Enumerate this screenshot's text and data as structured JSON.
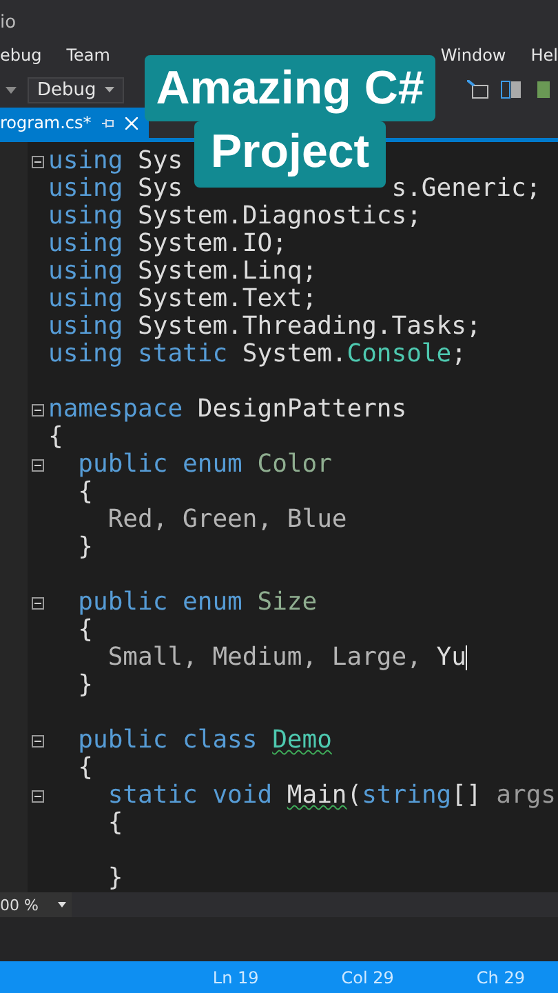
{
  "window": {
    "title": "io"
  },
  "menu": [
    {
      "kind": "item",
      "label": "ebug"
    },
    {
      "kind": "item",
      "label": "Team"
    },
    {
      "kind": "gap"
    },
    {
      "kind": "item",
      "label": "Window"
    },
    {
      "kind": "item",
      "label": "Hel"
    }
  ],
  "toolbar": {
    "configuration": "Debug"
  },
  "tab": {
    "label": "rogram.cs*",
    "selected": true
  },
  "code_lines": [
    {
      "fold": true,
      "tokens": [
        {
          "kind": "keyword",
          "text": "using"
        },
        {
          "kind": "plain",
          "text": " Sys"
        }
      ]
    },
    {
      "fold": false,
      "tokens": [
        {
          "kind": "keyword",
          "text": "using"
        },
        {
          "kind": "plain",
          "text": " Sys"
        },
        {
          "kind": "gap"
        },
        {
          "kind": "plain",
          "text": "s.Generic;"
        }
      ]
    },
    {
      "fold": false,
      "tokens": [
        {
          "kind": "keyword",
          "text": "using"
        },
        {
          "kind": "plain",
          "text": " System.Diagnostics;"
        }
      ]
    },
    {
      "fold": false,
      "tokens": [
        {
          "kind": "keyword",
          "text": "using"
        },
        {
          "kind": "plain",
          "text": " System.IO;"
        }
      ]
    },
    {
      "fold": false,
      "tokens": [
        {
          "kind": "keyword",
          "text": "using"
        },
        {
          "kind": "plain",
          "text": " System.Linq;"
        }
      ]
    },
    {
      "fold": false,
      "tokens": [
        {
          "kind": "keyword",
          "text": "using"
        },
        {
          "kind": "plain",
          "text": " System.Text;"
        }
      ]
    },
    {
      "fold": false,
      "tokens": [
        {
          "kind": "keyword",
          "text": "using"
        },
        {
          "kind": "plain",
          "text": " System.Threading.Tasks;"
        }
      ]
    },
    {
      "fold": false,
      "tokens": [
        {
          "kind": "keyword",
          "text": "using static"
        },
        {
          "kind": "plain",
          "text": " System."
        },
        {
          "kind": "type",
          "text": "Console"
        },
        {
          "kind": "plain",
          "text": ";"
        }
      ]
    },
    {
      "fold": false
    },
    {
      "fold": true,
      "tokens": [
        {
          "kind": "keyword",
          "text": "namespace"
        },
        {
          "kind": "plain",
          "text": " DesignPatterns"
        }
      ]
    },
    {
      "fold": false,
      "tokens": [
        {
          "kind": "plain",
          "text": "{"
        }
      ]
    },
    {
      "fold": true,
      "tokens": [
        {
          "kind": "keyword",
          "text": "  public enum"
        },
        {
          "kind": "enum",
          "text": " Color"
        }
      ]
    },
    {
      "fold": false,
      "tokens": [
        {
          "kind": "plain",
          "text": "  {"
        }
      ]
    },
    {
      "fold": false,
      "tokens": [
        {
          "kind": "member",
          "text": "    Red, Green, Blue"
        }
      ]
    },
    {
      "fold": false,
      "tokens": [
        {
          "kind": "plain",
          "text": "  }"
        }
      ]
    },
    {
      "fold": false
    },
    {
      "fold": true,
      "tokens": [
        {
          "kind": "keyword",
          "text": "  public enum"
        },
        {
          "kind": "enum",
          "text": " Size"
        }
      ]
    },
    {
      "fold": false,
      "tokens": [
        {
          "kind": "plain",
          "text": "  {"
        }
      ]
    },
    {
      "fold": false,
      "cursor": true,
      "tokens": [
        {
          "kind": "member",
          "text": "    Small, Medium, Large, "
        },
        {
          "kind": "plain",
          "text": "Yu"
        }
      ]
    },
    {
      "fold": false,
      "tokens": [
        {
          "kind": "plain",
          "text": "  }"
        }
      ]
    },
    {
      "fold": false
    },
    {
      "fold": true,
      "tokens": [
        {
          "kind": "keyword",
          "text": "  public class "
        },
        {
          "kind": "type",
          "text": "Demo",
          "squiggle": true
        }
      ]
    },
    {
      "fold": false,
      "tokens": [
        {
          "kind": "plain",
          "text": "  {"
        }
      ]
    },
    {
      "fold": true,
      "tokens": [
        {
          "kind": "keyword",
          "text": "    static void "
        },
        {
          "kind": "plain",
          "text": "Main",
          "squiggle": true
        },
        {
          "kind": "plain",
          "text": "("
        },
        {
          "kind": "keyword",
          "text": "string"
        },
        {
          "kind": "plain",
          "text": "[] "
        },
        {
          "kind": "param",
          "text": "args"
        }
      ]
    },
    {
      "fold": false,
      "tokens": [
        {
          "kind": "plain",
          "text": "    {"
        }
      ]
    },
    {
      "fold": false
    },
    {
      "fold": false,
      "tokens": [
        {
          "kind": "plain",
          "text": "    }"
        }
      ]
    }
  ],
  "zoom": "00 %",
  "status_bar": [
    "Ln 19",
    "Col 29",
    "Ch 29"
  ],
  "overlay": [
    "Amazing C#",
    "Project"
  ]
}
